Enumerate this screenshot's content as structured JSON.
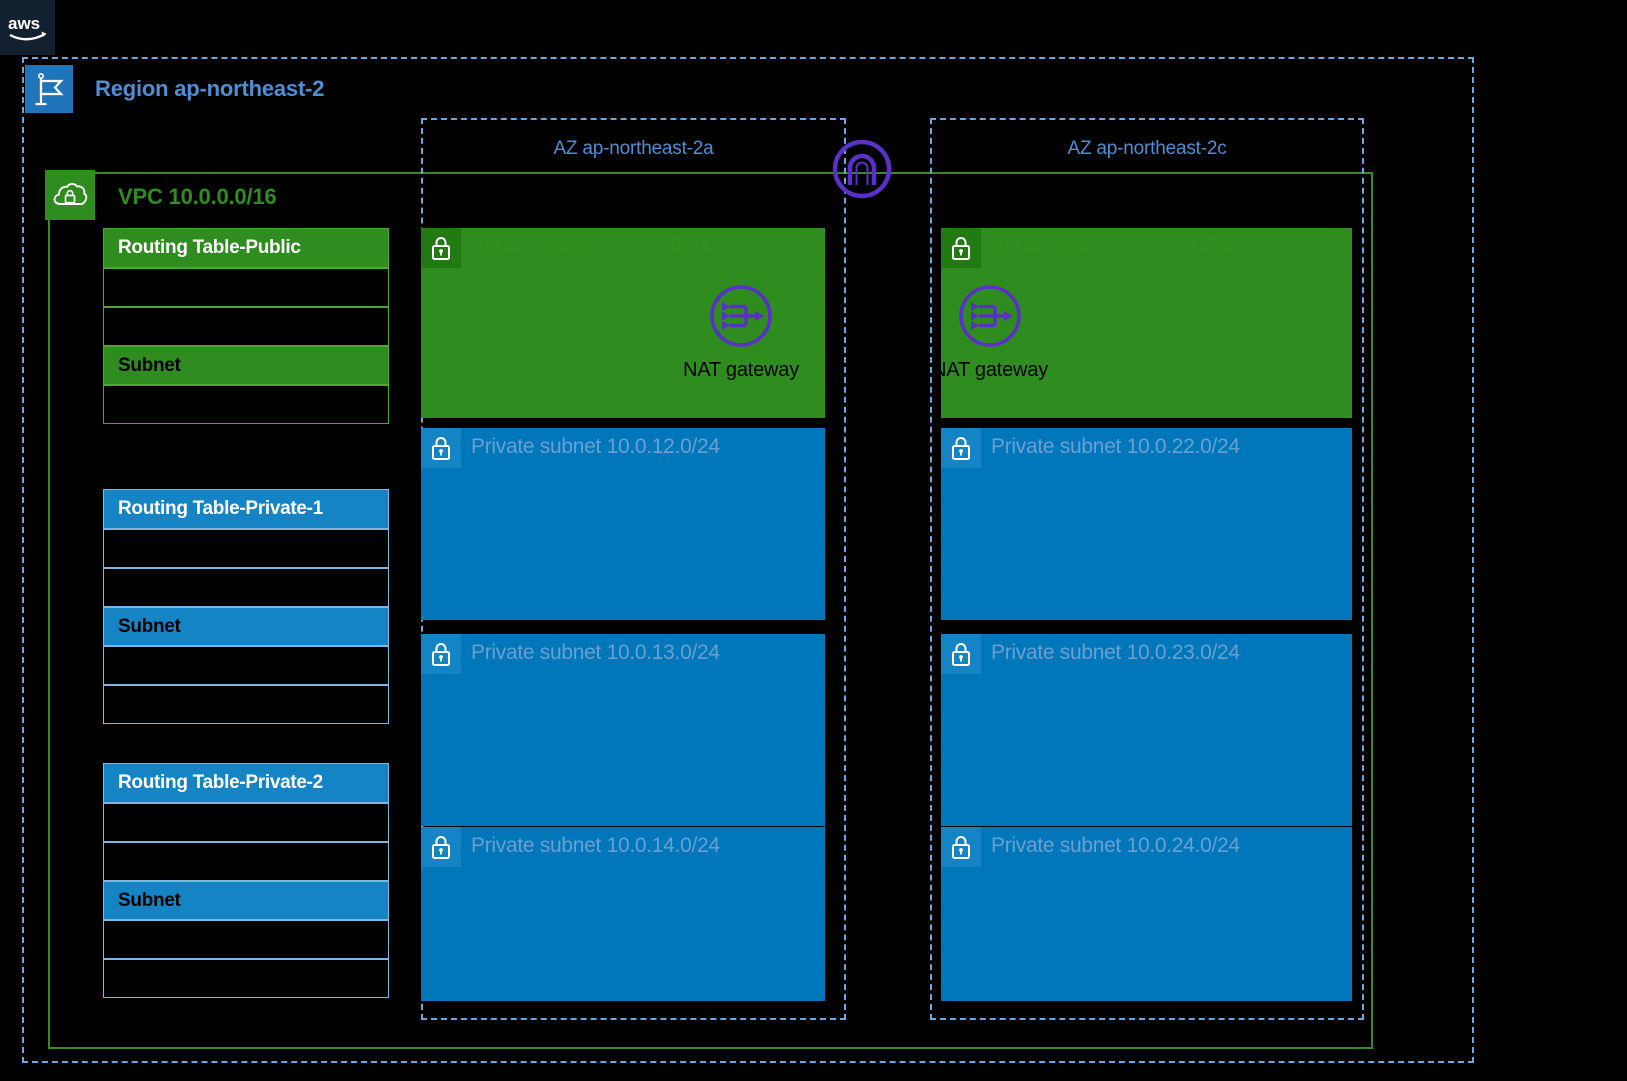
{
  "logo": {
    "alt": "aws-logo",
    "text": "aws"
  },
  "region": {
    "icon": "region-flag-icon",
    "label": "Region ap-northeast-2"
  },
  "vpc": {
    "icon": "vpc-cloud-lock-icon",
    "label": "VPC 10.0.0.0/16"
  },
  "internet_gateway": {
    "icon": "internet-gateway-icon",
    "label": ""
  },
  "availability_zones": [
    {
      "label": "AZ ap-northeast-2a"
    },
    {
      "label": "AZ ap-northeast-2c"
    }
  ],
  "routing_tables": [
    {
      "title": "Routing Table-Public",
      "color": "green",
      "rows_before": 2,
      "subnet_label": "Subnet",
      "rows_after": 1
    },
    {
      "title": "Routing Table-Private-1",
      "color": "blue",
      "rows_before": 2,
      "subnet_label": "Subnet",
      "rows_after": 2
    },
    {
      "title": "Routing Table-Private-2",
      "color": "blue",
      "rows_before": 2,
      "subnet_label": "Subnet",
      "rows_after": 2
    }
  ],
  "subnets": {
    "az_a": [
      {
        "label": "Public subnet 10.0.11.0/24",
        "type": "public"
      },
      {
        "label": "Private subnet 10.0.12.0/24",
        "type": "private"
      },
      {
        "label": "Private subnet 10.0.13.0/24",
        "type": "private"
      },
      {
        "label": "Private subnet 10.0.14.0/24",
        "type": "private"
      }
    ],
    "az_c": [
      {
        "label": "Public subnet 10.0.21.0/24",
        "type": "public"
      },
      {
        "label": "Private subnet 10.0.22.0/24",
        "type": "private"
      },
      {
        "label": "Private subnet 10.0.23.0/24",
        "type": "private"
      },
      {
        "label": "Private subnet 10.0.24.0/24",
        "type": "private"
      }
    ]
  },
  "nat_gateways": [
    {
      "label": "NAT gateway",
      "icon": "nat-gateway-icon"
    },
    {
      "label": "NAT gateway",
      "icon": "nat-gateway-icon"
    }
  ],
  "colors": {
    "background": "#000000",
    "region_border": "#6ca8e0",
    "region_text": "#4e8ed4",
    "vpc_border": "#3f8624",
    "vpc_green": "#2f8c1f",
    "subnet_blue": "#0077ba",
    "routing_blue": "#1484c4",
    "gateway_purple": "#5b2fc9"
  }
}
